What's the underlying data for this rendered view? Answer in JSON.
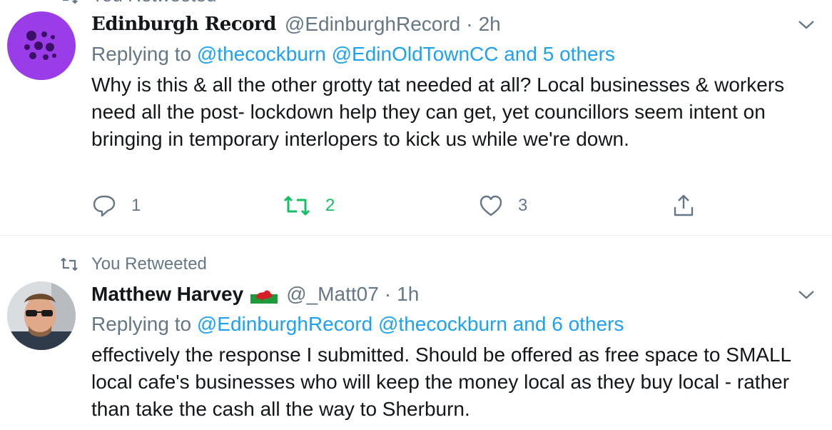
{
  "top_partial": {
    "label": "You Retweeted"
  },
  "tweets": [
    {
      "display_name": "Edinburgh Record",
      "handle": "@EdinburghRecord",
      "separator": "·",
      "time": "2h",
      "replying_prefix": "Replying to",
      "replying_to": "@thecockburn @EdinOldTownCC and 5 others",
      "text": "Why is this & all the other grotty tat needed at all? Local businesses & workers need all the post- lockdown help they can get, yet councillors seem intent on bringing in temporary interlopers to kick us while we're down.",
      "replies": "1",
      "retweets": "2",
      "likes": "3",
      "retweeted_by_you": true
    },
    {
      "retweet_label": "You Retweeted",
      "display_name": "Matthew Harvey",
      "handle": "@_Matt07",
      "separator": "·",
      "time": "1h",
      "replying_prefix": "Replying to",
      "replying_to": "@EdinburghRecord @thecockburn and 6 others",
      "text": "effectively the response I submitted. Should be offered as free space to SMALL local cafe's businesses who will keep the money local as they buy local - rather than take the cash all the way to Sherburn."
    }
  ],
  "colors": {
    "link": "#1da1f2",
    "muted": "#657786",
    "retweet_active": "#17bf63",
    "avatar_purple": "#9a3de8"
  },
  "icons": [
    "retweet-icon",
    "reply-icon",
    "like-icon",
    "share-icon",
    "chevron-down-icon",
    "wales-flag-icon"
  ]
}
